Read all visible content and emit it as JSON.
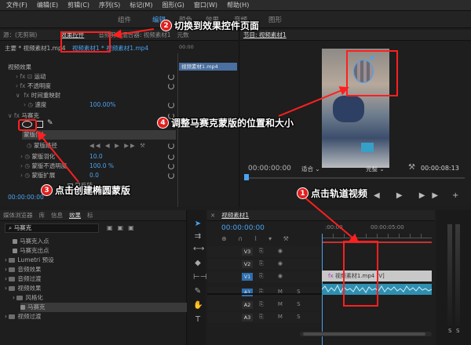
{
  "menu": [
    "文件(F)",
    "编辑(E)",
    "剪辑(C)",
    "序列(S)",
    "标记(M)",
    "图形(G)",
    "窗口(W)",
    "帮助(H)"
  ],
  "workspace": {
    "tabs": [
      "组件",
      "编辑",
      "颜色",
      "效果",
      "音频",
      "图形"
    ]
  },
  "effect_controls": {
    "tabs": [
      "源：(无剪辑)",
      "效果控件",
      "音频剪辑混合器: 视频素材1",
      "元数"
    ],
    "breadcrumb_master": "主要 * 视频素材1.mp4",
    "breadcrumb_clip": "视频素材1 * 视频素材1.mp4",
    "clip_label": "视频素材1.mp4",
    "section": "视频效果",
    "motion": "运动",
    "opacity": "不透明度",
    "time_remap": "时间重映射",
    "speed_label": "速度",
    "speed_value": "100.00%",
    "mosaic": "马赛克",
    "mask": "蒙版(1)",
    "mask_path": "蒙版路径",
    "mask_feather": "蒙版羽化",
    "mask_feather_value": "10.0",
    "mask_opacity": "蒙版不透明度",
    "mask_opacity_value": "100.0 %",
    "mask_expansion": "蒙版扩展",
    "mask_expansion_value": "0.0",
    "inverted": "已反转",
    "time": "00:00:00:00"
  },
  "program": {
    "title": "节目: 视频素材1",
    "timecode_left": "00:00:00:00",
    "fit": "适合",
    "quality": "完整",
    "timecode_right": "00:00:08:13"
  },
  "library": {
    "tabs": [
      "媒体浏览器",
      "库",
      "信息",
      "效果",
      "标"
    ],
    "search": "马赛克",
    "items": [
      {
        "label": "马赛克入点",
        "indent": 1,
        "type": "preset"
      },
      {
        "label": "马赛克出点",
        "indent": 1,
        "type": "preset"
      },
      {
        "label": "Lumetri 预设",
        "indent": 0,
        "type": "folder"
      },
      {
        "label": "音频效果",
        "indent": 0,
        "type": "folder"
      },
      {
        "label": "音频过渡",
        "indent": 0,
        "type": "folder"
      },
      {
        "label": "视频效果",
        "indent": 0,
        "type": "folder"
      },
      {
        "label": "风格化",
        "indent": 1,
        "type": "folder"
      },
      {
        "label": "马赛克",
        "indent": 2,
        "type": "effect"
      },
      {
        "label": "视频过渡",
        "indent": 0,
        "type": "folder"
      }
    ]
  },
  "timeline": {
    "tab": "视频素材1",
    "timecode": "00:00:00:00",
    "ruler": [
      ":00:00",
      "00:00:05:00"
    ],
    "tracks": [
      "V3",
      "V2",
      "V1",
      "A1",
      "A2",
      "A3"
    ],
    "clip_label": "视频素材1.mp4 [V]",
    "meter_labels": [
      "S",
      "S"
    ]
  },
  "annotations": [
    {
      "num": "1",
      "text": "点击轨道视频"
    },
    {
      "num": "2",
      "text": "切换到效果控件页面"
    },
    {
      "num": "3",
      "text": "点击创建椭圆蒙版"
    },
    {
      "num": "4",
      "text": "调整马赛克蒙版的位置和大小"
    }
  ],
  "colors": {
    "accent": "#4aa3f0",
    "annotation": "#ff1f1f",
    "clip_video": "#c8c8c8",
    "clip_audio": "#2f8fb0"
  }
}
